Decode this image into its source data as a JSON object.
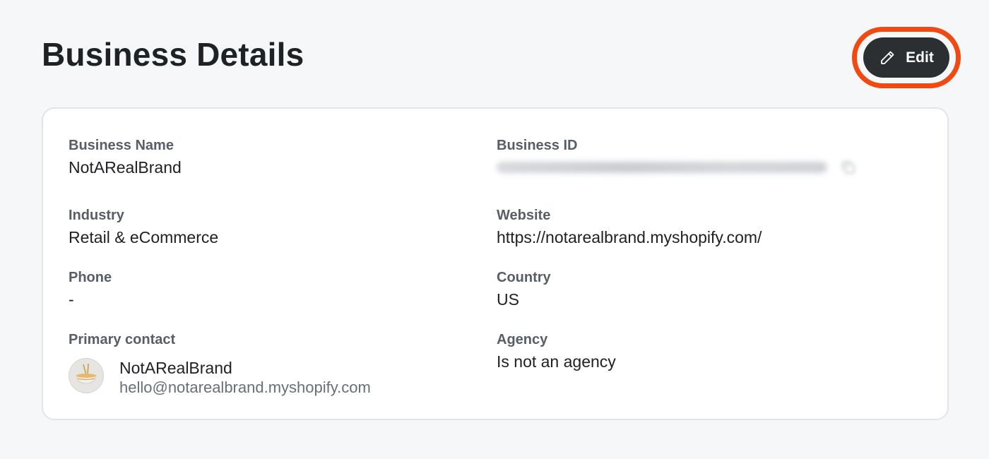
{
  "page": {
    "title": "Business Details"
  },
  "toolbar": {
    "edit_label": "Edit",
    "edit_icon": "pencil-icon",
    "highlight_color": "#f04a12"
  },
  "details": {
    "business_name": {
      "label": "Business Name",
      "value": "NotARealBrand"
    },
    "business_id": {
      "label": "Business ID",
      "copy_icon": "copy-icon"
    },
    "industry": {
      "label": "Industry",
      "value": "Retail & eCommerce"
    },
    "website": {
      "label": "Website",
      "value": "https://notarealbrand.myshopify.com/"
    },
    "phone": {
      "label": "Phone",
      "value": "-"
    },
    "country": {
      "label": "Country",
      "value": "US"
    },
    "primary_contact": {
      "label": "Primary contact",
      "name": "NotARealBrand",
      "email": "hello@notarealbrand.myshopify.com",
      "avatar_icon": "noodle-bowl-icon"
    },
    "agency": {
      "label": "Agency",
      "value": "Is not an agency"
    }
  }
}
